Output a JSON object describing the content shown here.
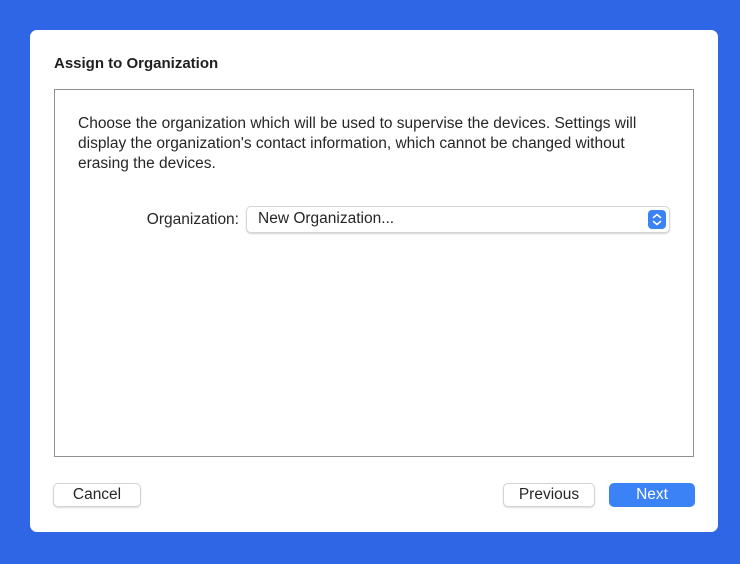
{
  "dialog": {
    "title": "Assign to Organization",
    "description": "Choose the organization which will be used to supervise the devices. Settings will display the organization's contact information, which cannot be changed without erasing the devices.",
    "organization_label": "Organization:",
    "organization_selected": "New Organization...",
    "stepper_icon": "up-down-chevrons"
  },
  "buttons": {
    "cancel": "Cancel",
    "previous": "Previous",
    "next": "Next"
  },
  "colors": {
    "background": "#2f66e6",
    "accent": "#3b82f6"
  }
}
